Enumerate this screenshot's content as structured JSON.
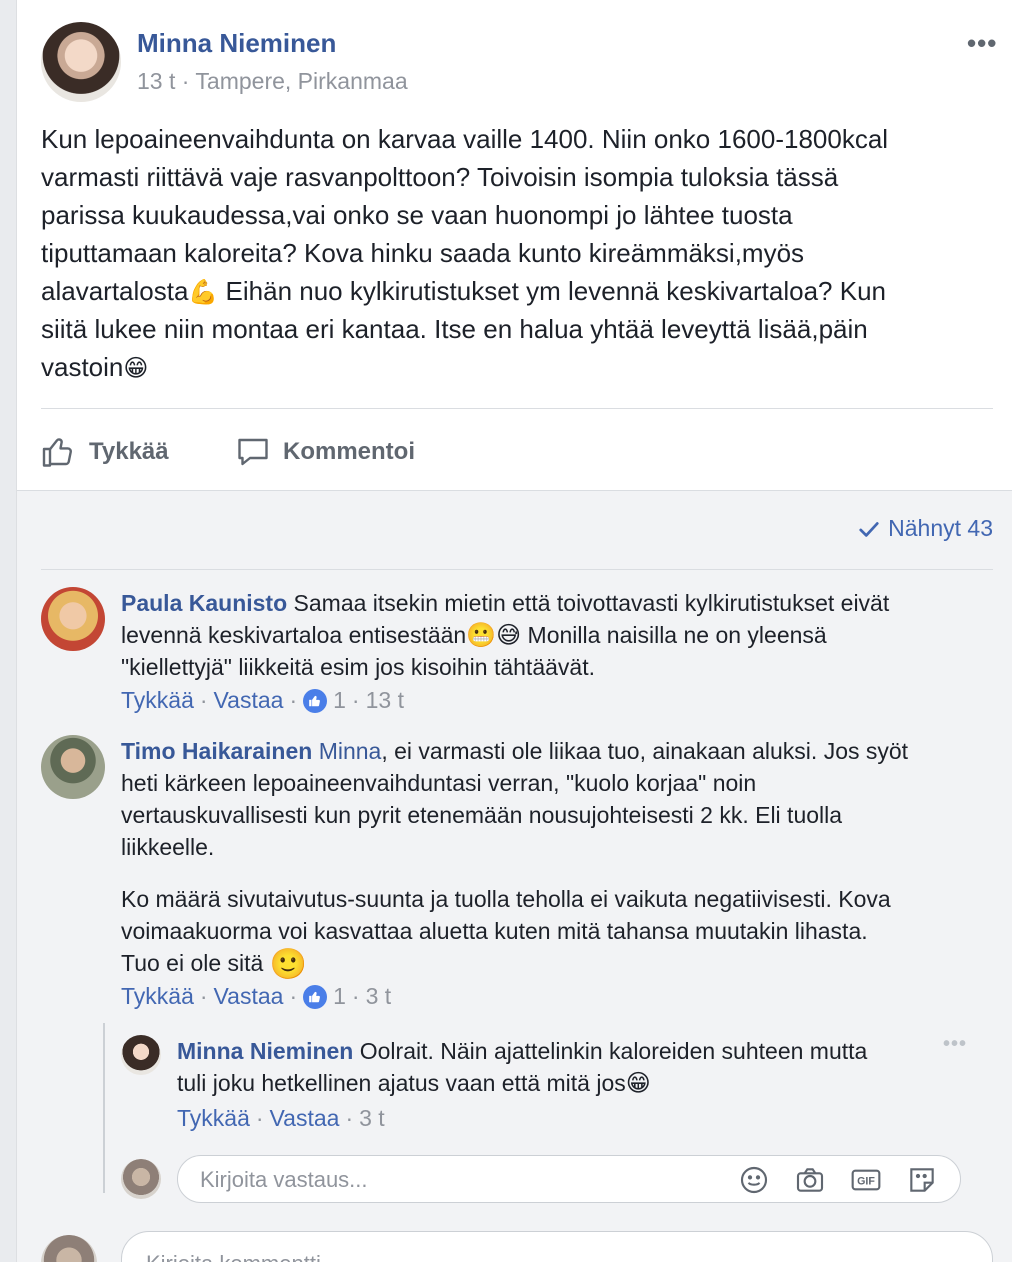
{
  "post": {
    "author": "Minna Nieminen",
    "time": "13 t",
    "meta_separator": "·",
    "location": "Tampere, Pirkanmaa",
    "more": "•••",
    "text_lines": [
      "Kun lepoaineenvaihdunta on karvaa vaille 1400. Niin onko 1600-1800kcal",
      "varmasti riittävä vaje rasvanpolttoon? Toivoisin isompia tuloksia tässä",
      "parissa kuukaudessa,vai onko se vaan huonompi jo lähtee tuosta",
      "tiputtamaan kaloreita? Kova hinku saada kunto kireämmäksi,myös"
    ],
    "line5_before": "alavartalosta",
    "line5_emoji": "💪",
    "line5_after": " Eihän nuo kylkirutistukset ym levennä keskivartaloa? Kun",
    "line6": "siitä lukee niin montaa eri kantaa. Itse en halua yhtää leveyttä lisää,päin",
    "line7": "vastoin",
    "line7_emoji": "😁"
  },
  "actions": {
    "like": "Tykkää",
    "comment": "Kommentoi"
  },
  "seen": {
    "label": "Nähnyt 43"
  },
  "comments": [
    {
      "author": "Paula Kaunisto",
      "line1": " Samaa itsekin mietin että toivottavasti kylkirutistukset eivät",
      "line2_before": "levennä keskivartaloa entisestään",
      "line2_emoji1": "😬",
      "line2_emoji2": "😅",
      "line2_after": " Monilla naisilla ne on yleensä",
      "line3": "\"kiellettyjä\" liikkeitä esim jos kisoihin tähtäävät.",
      "like": "Tykkää",
      "reply": "Vastaa",
      "like_count": "1",
      "time": "13 t"
    },
    {
      "author": "Timo Haikarainen",
      "mention": "Minna",
      "line1": ", ei varmasti ole liikaa tuo, ainakaan aluksi. Jos syöt",
      "line2": "heti kärkeen lepoaineenvaihduntasi verran, \"kuolo korjaa\" noin",
      "line3": "vertauskuvallisesti kun pyrit etenemään nousujohteisesti 2 kk. Eli tuolla",
      "line4": "liikkeelle.",
      "p2_line1": "Ko määrä sivutaivutus-suunta ja tuolla teholla ei vaikuta negatiivisesti. Kova",
      "p2_line2": "voimaakuorma voi kasvattaa aluetta kuten mitä tahansa muutakin lihasta.",
      "p2_line3": "Tuo ei ole sitä ",
      "p2_emoji": "🙂",
      "like": "Tykkää",
      "reply": "Vastaa",
      "like_count": "1",
      "time": "3 t"
    }
  ],
  "reply": {
    "author": "Minna Nieminen",
    "line1": " Oolrait. Näin ajattelinkin kaloreiden suhteen mutta",
    "line2": "tuli joku hetkellinen ajatus vaan että mitä jos",
    "emoji": "😁",
    "more": "•••",
    "like": "Tykkää",
    "reply": "Vastaa",
    "time": "3 t"
  },
  "reply_input": {
    "placeholder": "Kirjoita vastaus..."
  },
  "comment_input": {
    "placeholder": "Kirjoita kommentti..."
  },
  "icons": {
    "like": "thumbs-up-icon",
    "comment": "speech-bubble-icon",
    "seen": "checkmark-icon",
    "emoji": "smiley-icon",
    "camera": "camera-icon",
    "gif": "gif-icon",
    "sticker": "sticker-icon",
    "options": "more-options-icon"
  },
  "colors": {
    "link": "#385898",
    "accent": "#4267b2",
    "muted": "#90949c",
    "text": "#1d2129"
  }
}
